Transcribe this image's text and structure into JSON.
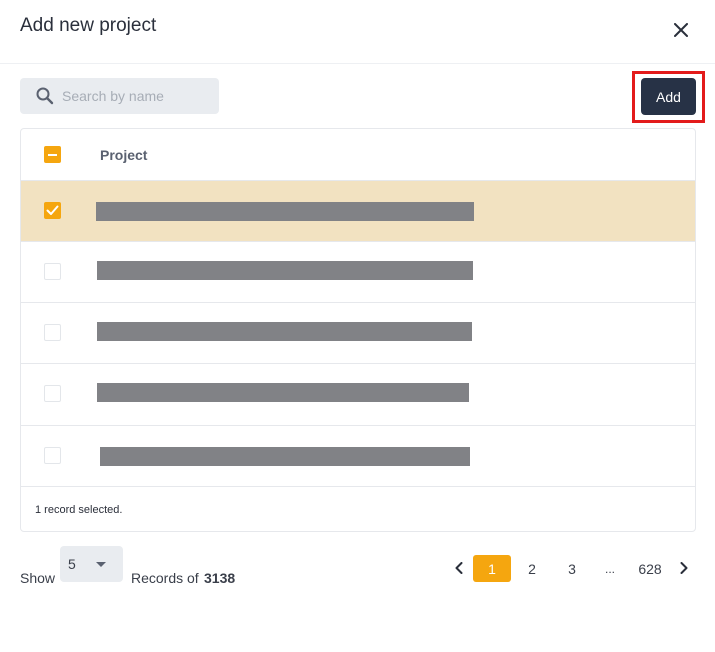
{
  "dialog": {
    "title": "Add new project"
  },
  "toolbar": {
    "search_placeholder": "Search by name",
    "add_label": "Add"
  },
  "table": {
    "columns": [
      "Project"
    ],
    "rows": [
      {
        "selected": true
      },
      {
        "selected": false
      },
      {
        "selected": false
      },
      {
        "selected": false
      },
      {
        "selected": false
      }
    ],
    "status": "1 record selected."
  },
  "pagination": {
    "show_label": "Show",
    "page_size": "5",
    "records_label": "Records of",
    "records_total": "3138",
    "pages": [
      "1",
      "2",
      "3",
      "...",
      "628"
    ],
    "current_page": "1"
  },
  "colors": {
    "accent": "#f5a60f",
    "primary_button": "#273246",
    "selected_row": "#f2e2c1",
    "highlight": "#e31b1b"
  },
  "icons": [
    "close-icon",
    "search-icon",
    "check-icon",
    "chevron-left-icon",
    "chevron-right-icon",
    "caret-down-icon"
  ]
}
